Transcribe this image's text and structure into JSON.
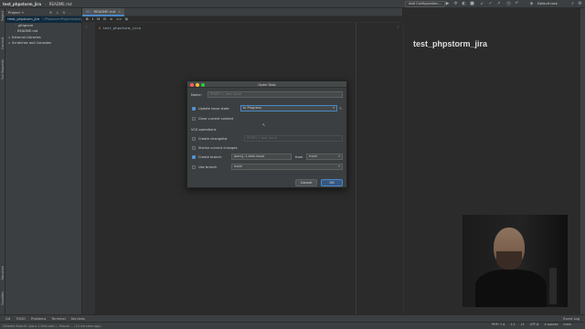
{
  "topbar": {
    "project": "test_phpstorm_jira",
    "file": "README.md",
    "run_config": "Add Configuration...",
    "task": "Default task"
  },
  "left_strip": {
    "items": [
      "Project",
      "Commit",
      "Pull Requests",
      "Structure",
      "Favorites"
    ]
  },
  "project_panel": {
    "header": "Project",
    "tree": [
      {
        "label": "test_phpstorm_jira",
        "path": "~/PhpstormProjects/test_phpstorm_jira",
        "indent": 0,
        "glyph": "▾"
      },
      {
        "label": ".gitignore",
        "path": "",
        "indent": 2,
        "glyph": "·"
      },
      {
        "label": "README.md",
        "path": "",
        "indent": 2,
        "glyph": "·"
      },
      {
        "label": "External Libraries",
        "path": "",
        "indent": 0,
        "glyph": "▸"
      },
      {
        "label": "Scratches and Consoles",
        "path": "",
        "indent": 0,
        "glyph": "▸"
      }
    ]
  },
  "editor": {
    "tab": "README.md",
    "tools": [
      "B",
      "I",
      "H",
      "⊟",
      "≡",
      "<>",
      "⧉"
    ],
    "line_number": "1",
    "code_hash": "#",
    "code_text": "test_phpstorm_jira"
  },
  "preview": {
    "title": "test_phpstorm_jira"
  },
  "dialog": {
    "title": "Open Task",
    "name_label": "Name:",
    "name_placeholder": "IPSRO-1: test issue",
    "update_state_label": "Update issue state",
    "update_state_value": "In Progress",
    "clear_context_label": "Clear current context",
    "vcs_label": "VCS operations",
    "create_changelist_label": "Create changelist",
    "changelist_placeholder": "IPSRO-1 test issue",
    "shelve_label": "Shelve current changes",
    "create_branch_label": "Create branch",
    "branch_name": "ipsro}-1-test-issue",
    "from_label": "from",
    "from_value": "main",
    "use_branch_label": "Use branch",
    "use_branch_value": "main",
    "cancel_label": "Cancel",
    "ok_label": "OK"
  },
  "bottom_tools": [
    "Git",
    "TODO",
    "Problems",
    "Terminal",
    "Services"
  ],
  "event_log": "Event Log",
  "status": {
    "message": "Deleted Branch: ipsro-1-first-task (...Rstore ... (10 minutes ago)",
    "right": [
      "PHP: 7.4",
      "1:1",
      "LF",
      "UTF-8",
      "4 spaces",
      "main"
    ]
  },
  "colors": {
    "accent": "#4a88c7",
    "dialog_bg": "#3c3f41",
    "editor_bg": "#2b2b2b"
  }
}
